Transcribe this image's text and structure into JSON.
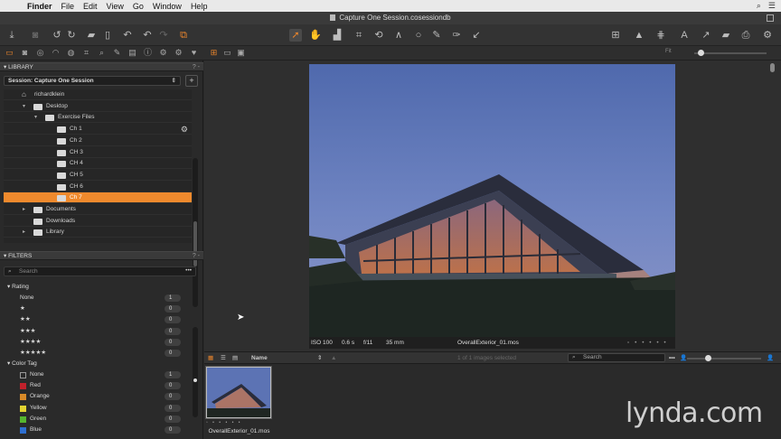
{
  "menubar": {
    "app": "Finder",
    "items": [
      "File",
      "Edit",
      "View",
      "Go",
      "Window",
      "Help"
    ]
  },
  "window": {
    "title": "Capture One Session.cosessiondb"
  },
  "library": {
    "header": "LIBRARY",
    "header_ctl": "? -",
    "session_label": "Session: Capture One Session",
    "tree": [
      {
        "label": "richardklein",
        "indent": 0,
        "kind": "home"
      },
      {
        "label": "Desktop",
        "indent": 1,
        "kind": "folder",
        "expanded": true
      },
      {
        "label": "Exercise Files",
        "indent": 2,
        "kind": "folder",
        "expanded": true
      },
      {
        "label": "Ch 1",
        "indent": 3,
        "kind": "folder"
      },
      {
        "label": "Ch 2",
        "indent": 3,
        "kind": "folder"
      },
      {
        "label": "CH 3",
        "indent": 3,
        "kind": "folder"
      },
      {
        "label": "CH 4",
        "indent": 3,
        "kind": "folder"
      },
      {
        "label": "CH 5",
        "indent": 3,
        "kind": "folder"
      },
      {
        "label": "CH 6",
        "indent": 3,
        "kind": "folder"
      },
      {
        "label": "Ch 7",
        "indent": 3,
        "kind": "folder",
        "selected": true
      },
      {
        "label": "Documents",
        "indent": 1,
        "kind": "folder",
        "collapsed": true
      },
      {
        "label": "Downloads",
        "indent": 1,
        "kind": "folder"
      },
      {
        "label": "Library",
        "indent": 1,
        "kind": "folder",
        "collapsed": true
      }
    ]
  },
  "filters": {
    "header": "FILTERS",
    "header_ctl": "? -",
    "search_placeholder": "Search",
    "rating_group": "Rating",
    "ratings": [
      {
        "label": "None",
        "count": "1"
      },
      {
        "label": "★",
        "count": "0"
      },
      {
        "label": "★★",
        "count": "0"
      },
      {
        "label": "★★★",
        "count": "0"
      },
      {
        "label": "★★★★",
        "count": "0"
      },
      {
        "label": "★★★★★",
        "count": "0"
      }
    ],
    "color_group": "Color Tag",
    "colors": [
      {
        "label": "None",
        "count": "1",
        "color": "#2a2a2a"
      },
      {
        "label": "Red",
        "count": "0",
        "color": "#c0212b"
      },
      {
        "label": "Orange",
        "count": "0",
        "color": "#d88a28"
      },
      {
        "label": "Yellow",
        "count": "0",
        "color": "#e2d331"
      },
      {
        "label": "Green",
        "count": "0",
        "color": "#55b52f"
      },
      {
        "label": "Blue",
        "count": "0",
        "color": "#2e6fd1"
      }
    ]
  },
  "viewer": {
    "iso": "ISO 100",
    "shutter": "0.6 s",
    "aperture": "f/11",
    "focal": "35 mm",
    "filename": "OverallExterior_01.mos",
    "fit_label": "Fit"
  },
  "browser": {
    "sort_label": "Name",
    "status": "1 of 1 images selected",
    "search_placeholder": "Search",
    "thumb_name": "OverallExterior_01.mos"
  },
  "watermark": "lynda.com"
}
